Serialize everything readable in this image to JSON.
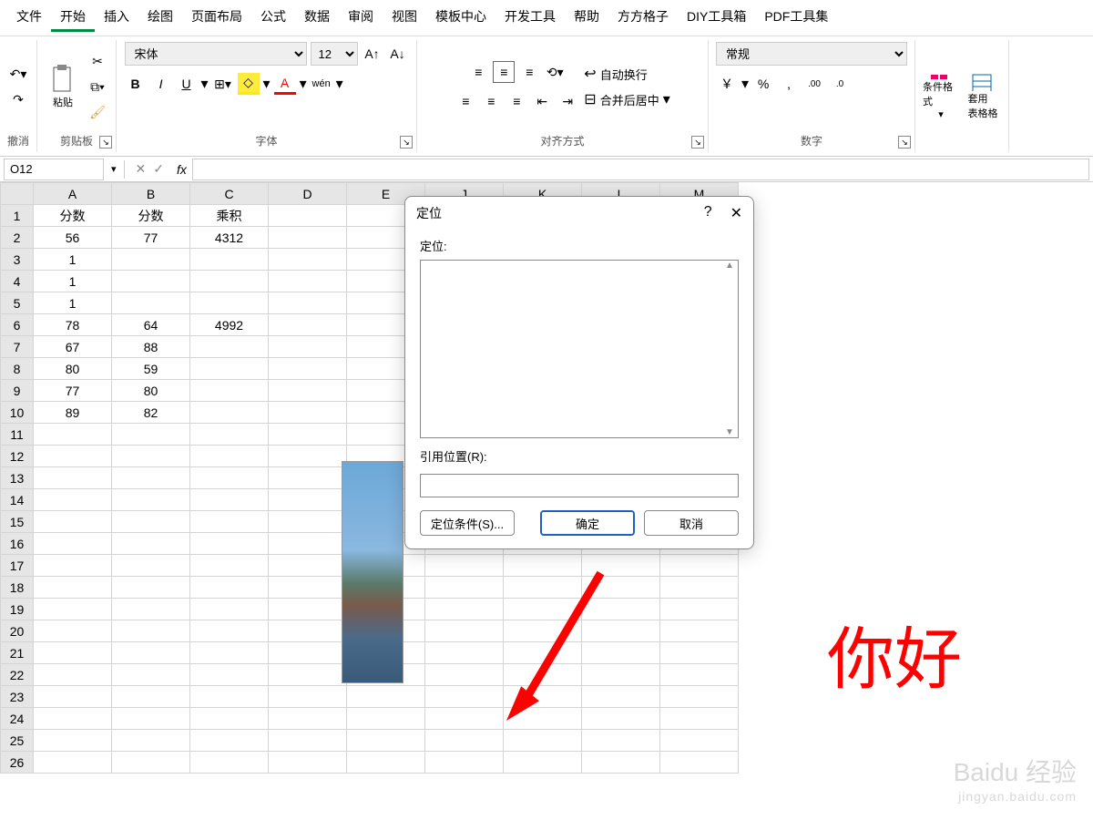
{
  "menu": {
    "items": [
      "文件",
      "开始",
      "插入",
      "绘图",
      "页面布局",
      "公式",
      "数据",
      "审阅",
      "视图",
      "模板中心",
      "开发工具",
      "帮助",
      "方方格子",
      "DIY工具箱",
      "PDF工具集"
    ],
    "active_index": 1
  },
  "ribbon": {
    "undo": {
      "label": "撤消"
    },
    "clipboard": {
      "label": "剪贴板",
      "paste": "粘贴"
    },
    "font": {
      "label": "字体",
      "name": "宋体",
      "size": "12",
      "bold": "B",
      "italic": "I",
      "underline": "U",
      "pinyin": "wén"
    },
    "align": {
      "label": "对齐方式",
      "wrap": "自动换行",
      "merge": "合并后居中"
    },
    "number": {
      "label": "数字",
      "format": "常规",
      "currency": "￥",
      "percent": "%",
      "comma": ",",
      "inc": ".00",
      "dec": ".0"
    },
    "styles": {
      "conditional": "条件格式",
      "table": "套用\n表格格"
    }
  },
  "namebox": {
    "cell": "O12",
    "fx": "fx"
  },
  "columns": [
    "A",
    "B",
    "C",
    "D",
    "E",
    "J",
    "K",
    "L",
    "M"
  ],
  "row_count": 26,
  "cells": {
    "A1": "分数",
    "B1": "分数",
    "C1": "乘积",
    "A2": "56",
    "B2": "77",
    "C2": "4312",
    "A3": "1",
    "A4": "1",
    "A5": "1",
    "A6": "78",
    "B6": "64",
    "C6": "4992",
    "A7": "67",
    "B7": "88",
    "A8": "80",
    "B8": "59",
    "A9": "77",
    "B9": "80",
    "A10": "89",
    "B10": "82"
  },
  "dialog": {
    "title": "定位",
    "help": "?",
    "close": "✕",
    "goto_label": "定位:",
    "ref_label": "引用位置(R):",
    "ref_value": "",
    "special_btn": "定位条件(S)...",
    "ok_btn": "确定",
    "cancel_btn": "取消"
  },
  "annotation": "你好",
  "watermark": {
    "brand": "Baidu 经验",
    "sub": "jingyan.baidu.com"
  }
}
